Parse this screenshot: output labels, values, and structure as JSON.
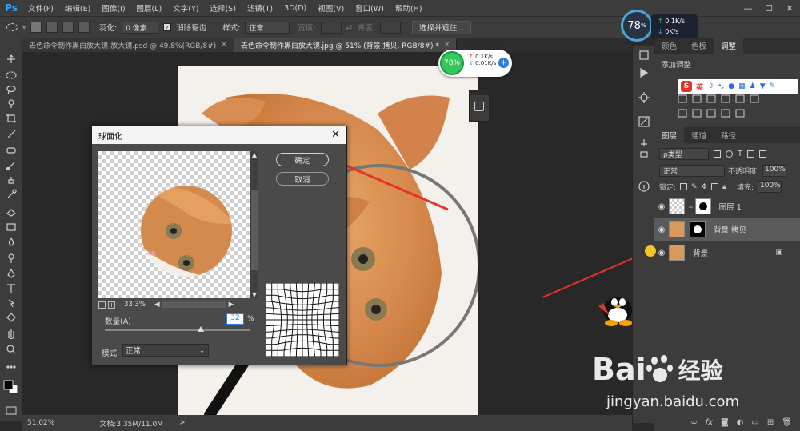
{
  "menubar": {
    "logo": "Ps",
    "items": [
      "文件(F)",
      "编辑(E)",
      "图像(I)",
      "图层(L)",
      "文字(Y)",
      "选择(S)",
      "滤镜(T)",
      "3D(D)",
      "视图(V)",
      "窗口(W)",
      "帮助(H)"
    ],
    "window_controls": [
      "—",
      "☐",
      "✕"
    ]
  },
  "options": {
    "feather_label": "羽化:",
    "feather_value": "0 像素",
    "antialias_label": "消除锯齿",
    "antialias_checked": true,
    "style_label": "样式:",
    "style_value": "正常",
    "width_label": "宽度:",
    "height_label": "高度:",
    "select_mask_label": "选择并遮住..."
  },
  "tabs": [
    {
      "label": "去色命令制作黑白放大镜-放大镜.psd @ 49.8%(RGB/8#)",
      "close": "×",
      "active": false
    },
    {
      "label": "去色命令制作黑白放大镜.jpg @ 51% (背景 拷贝, RGB/8#) *",
      "close": "×",
      "active": true
    }
  ],
  "status": {
    "zoom": "51.02%",
    "doc_size": "文档:3.35M/11.0M",
    "arrow": ">"
  },
  "network_big": {
    "percent": "78",
    "unit": "%",
    "up": "0.1K/s",
    "down": "0K/s"
  },
  "network_small": {
    "percent": "78%",
    "up": "0.1K/s",
    "down": "0.01K/s",
    "plus": "+"
  },
  "dialog": {
    "title": "球面化",
    "close": "✕",
    "ok_label": "确定",
    "cancel_label": "取消",
    "zoom_minus": "−",
    "zoom_plus": "+",
    "zoom_value": "33.3%",
    "amount_label": "数量(A)",
    "amount_value": "32",
    "amount_unit": "%",
    "amount_level": 0.66,
    "mode_label": "模式",
    "mode_value": "正常"
  },
  "panels": {
    "top_tabs": [
      "颜色",
      "色板",
      "调整"
    ],
    "adjust_title": "添加调整",
    "ime_label": "英",
    "layer_tabs": [
      "图层",
      "通道",
      "路径"
    ],
    "kind_filter": "ρ类型",
    "blend_mode": "正常",
    "opacity_label": "不透明度:",
    "opacity_value": "100%",
    "lock_label": "锁定:",
    "fill_label": "填充:",
    "fill_value": "100%",
    "layers": [
      {
        "name": "图层 1",
        "selected": false,
        "locked": false
      },
      {
        "name": "背景 拷贝",
        "selected": true,
        "locked": false
      },
      {
        "name": "背景",
        "selected": false,
        "locked": true
      }
    ],
    "bottom_icons": [
      "link-icon",
      "fx-icon",
      "mask-icon",
      "adjustment-icon",
      "folder-icon",
      "new-layer-icon",
      "trash-icon"
    ],
    "fx_label": "fx"
  },
  "watermark": {
    "brand": "Bai",
    "brand_suffix": "du",
    "chinese": "经验",
    "url": "jingyan.baidu.com"
  },
  "colors": {
    "app_bg": "#3c3c3c",
    "canvas_bg": "#282828",
    "accent": "#31a8ff",
    "arrow_red": "#e8322a",
    "net_green": "#34c759"
  }
}
